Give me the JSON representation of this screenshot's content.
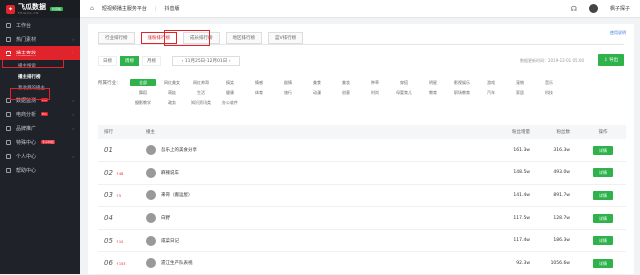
{
  "brand": {
    "name": "飞瓜数据",
    "sub": "FEIGUA.CN",
    "badge": "抖音版"
  },
  "sidebar": {
    "items": [
      {
        "label": "工作台",
        "icon": "home-icon"
      },
      {
        "label": "热门素材",
        "icon": "fire-icon",
        "arrow": "›"
      },
      {
        "label": "播主查找",
        "icon": "user-icon",
        "arrow": "⌃",
        "active": true
      },
      {
        "label": "数据监测",
        "icon": "monitor-icon",
        "badge": "Pro",
        "arrow": "›"
      },
      {
        "label": "电商分析",
        "icon": "cart-icon",
        "badge": "Pro",
        "arrow": "›"
      },
      {
        "label": "品牌推广",
        "icon": "brand-icon",
        "arrow": "›"
      },
      {
        "label": "特殊中心",
        "icon": "star-icon",
        "badge": "专享特权"
      },
      {
        "label": "个人中心",
        "icon": "person-icon",
        "arrow": "›"
      },
      {
        "label": "帮助中心",
        "icon": "help-icon"
      }
    ],
    "sub_items": [
      "播主搜索",
      "播主排行榜",
      "我收藏的播主"
    ]
  },
  "topbar": {
    "platform": "短视频播主服务平台",
    "category": "抖音版",
    "user": "枫子探子"
  },
  "tabs": [
    "行业排行榜",
    "涨粉排行榜",
    "成长排行榜",
    "地区排行榜",
    "蓝V排行榜"
  ],
  "howto": "使用说明",
  "period": {
    "options": [
      "日榜",
      "周榜",
      "月榜"
    ],
    "active": 1,
    "date_range": "11月25日-12月01日"
  },
  "updated": "数据更新时间：2019-12-01 05:00",
  "export_label": "导出",
  "industry": {
    "label": "所属行业：",
    "items": [
      "全部",
      "网红美女",
      "网红帅哥",
      "搞笑",
      "情感",
      "剧情",
      "美食",
      "美妆",
      "种草",
      "穿搭",
      "明星",
      "影视娱乐",
      "游戏",
      "宠物",
      "音乐",
      "舞蹈",
      "萌娃",
      "生活",
      "健康",
      "体育",
      "旅行",
      "动漫",
      "创意",
      "时尚",
      "母婴育儿",
      "教育",
      "职场教育",
      "汽车",
      "家居",
      "科技",
      "摄影教学",
      "政务",
      "知识资讯类",
      "办公软件"
    ]
  },
  "table": {
    "headers": {
      "rank": "排行",
      "anchor": "播主",
      "increase": "粉丝增量",
      "fans": "粉丝数",
      "action": "操作"
    },
    "rows": [
      {
        "rank": "01",
        "change": "",
        "change_dir": "",
        "name": "吾乐上的美食分享",
        "increase": "161.3w",
        "fans": "316.3w",
        "action": "详情"
      },
      {
        "rank": "02",
        "change": "↑48",
        "change_dir": "up",
        "name": "麻辣说车",
        "increase": "148.5w",
        "fans": "493.0w",
        "action": "详情"
      },
      {
        "rank": "03",
        "change": "↑5",
        "change_dir": "up",
        "name": "来哥（搬运屋）",
        "increase": "141.4w",
        "fans": "891.7w",
        "action": "详情"
      },
      {
        "rank": "04",
        "change": "",
        "change_dir": "",
        "name": "白野",
        "increase": "117.5w",
        "fans": "128.7w",
        "action": "详情"
      },
      {
        "rank": "05",
        "change": "↑10",
        "change_dir": "up",
        "name": "咸菜日记",
        "increase": "117.4w",
        "fans": "186.3w",
        "action": "详情"
      },
      {
        "rank": "06",
        "change": "↑153",
        "change_dir": "up",
        "name": "遗江生产队表视",
        "increase": "92.3w",
        "fans": "1056.6w",
        "action": "详情"
      }
    ]
  },
  "colors": {
    "accent": "#e1232c",
    "green": "#2fb24c",
    "sidebar": "#1f2329"
  }
}
